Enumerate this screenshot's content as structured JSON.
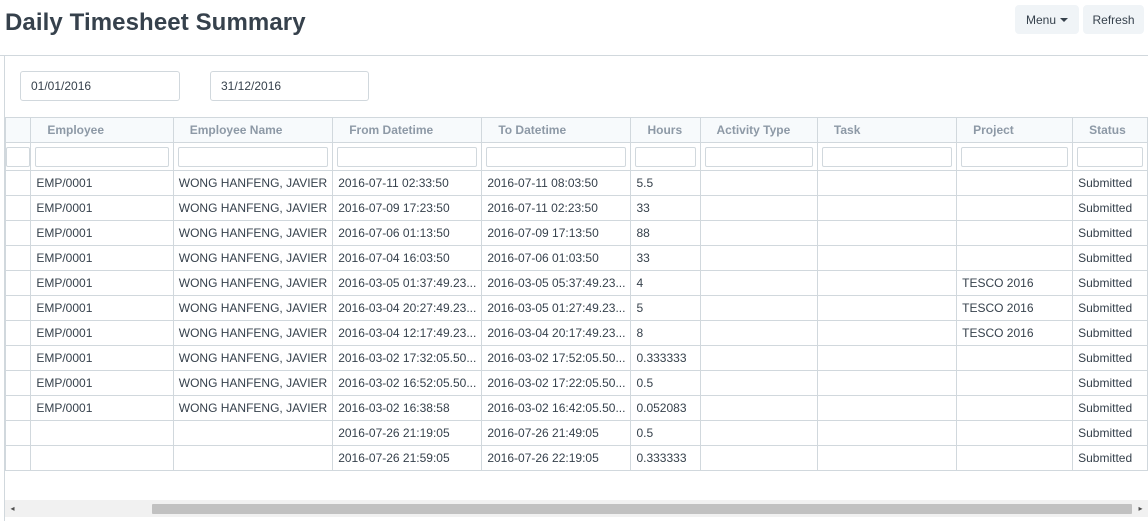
{
  "page": {
    "title": "Daily Timesheet Summary",
    "menu_label": "Menu",
    "refresh_label": "Refresh"
  },
  "filters": {
    "from_date": "01/01/2016",
    "to_date": "31/12/2016"
  },
  "table": {
    "columns": [
      "Employee",
      "Employee Name",
      "From Datetime",
      "To Datetime",
      "Hours",
      "Activity Type",
      "Task",
      "Project",
      "Status"
    ],
    "rows": [
      [
        "EMP/0001",
        "WONG HANFENG, JAVIER",
        "2016-07-11 02:33:50",
        "2016-07-11 08:03:50",
        "5.5",
        "",
        "",
        "",
        "Submitted"
      ],
      [
        "EMP/0001",
        "WONG HANFENG, JAVIER",
        "2016-07-09 17:23:50",
        "2016-07-11 02:23:50",
        "33",
        "",
        "",
        "",
        "Submitted"
      ],
      [
        "EMP/0001",
        "WONG HANFENG, JAVIER",
        "2016-07-06 01:13:50",
        "2016-07-09 17:13:50",
        "88",
        "",
        "",
        "",
        "Submitted"
      ],
      [
        "EMP/0001",
        "WONG HANFENG, JAVIER",
        "2016-07-04 16:03:50",
        "2016-07-06 01:03:50",
        "33",
        "",
        "",
        "",
        "Submitted"
      ],
      [
        "EMP/0001",
        "WONG HANFENG, JAVIER",
        "2016-03-05 01:37:49.23...",
        "2016-03-05 05:37:49.23...",
        "4",
        "",
        "",
        "TESCO 2016",
        "Submitted"
      ],
      [
        "EMP/0001",
        "WONG HANFENG, JAVIER",
        "2016-03-04 20:27:49.23...",
        "2016-03-05 01:27:49.23...",
        "5",
        "",
        "",
        "TESCO 2016",
        "Submitted"
      ],
      [
        "EMP/0001",
        "WONG HANFENG, JAVIER",
        "2016-03-04 12:17:49.23...",
        "2016-03-04 20:17:49.23...",
        "8",
        "",
        "",
        "TESCO 2016",
        "Submitted"
      ],
      [
        "EMP/0001",
        "WONG HANFENG, JAVIER",
        "2016-03-02 17:32:05.50...",
        "2016-03-02 17:52:05.50...",
        "0.333333",
        "",
        "",
        "",
        "Submitted"
      ],
      [
        "EMP/0001",
        "WONG HANFENG, JAVIER",
        "2016-03-02 16:52:05.50...",
        "2016-03-02 17:22:05.50...",
        "0.5",
        "",
        "",
        "",
        "Submitted"
      ],
      [
        "EMP/0001",
        "WONG HANFENG, JAVIER",
        "2016-03-02 16:38:58",
        "2016-03-02 16:42:05.50...",
        "0.052083",
        "",
        "",
        "",
        "Submitted"
      ],
      [
        "",
        "",
        "2016-07-26 21:19:05",
        "2016-07-26 21:49:05",
        "0.5",
        "",
        "",
        "",
        "Submitted"
      ],
      [
        "",
        "",
        "2016-07-26 21:59:05",
        "2016-07-26 22:19:05",
        "0.333333",
        "",
        "",
        "",
        "Submitted"
      ]
    ]
  },
  "scrollbar": {
    "left_arrow": "◂",
    "right_arrow": "▸"
  }
}
